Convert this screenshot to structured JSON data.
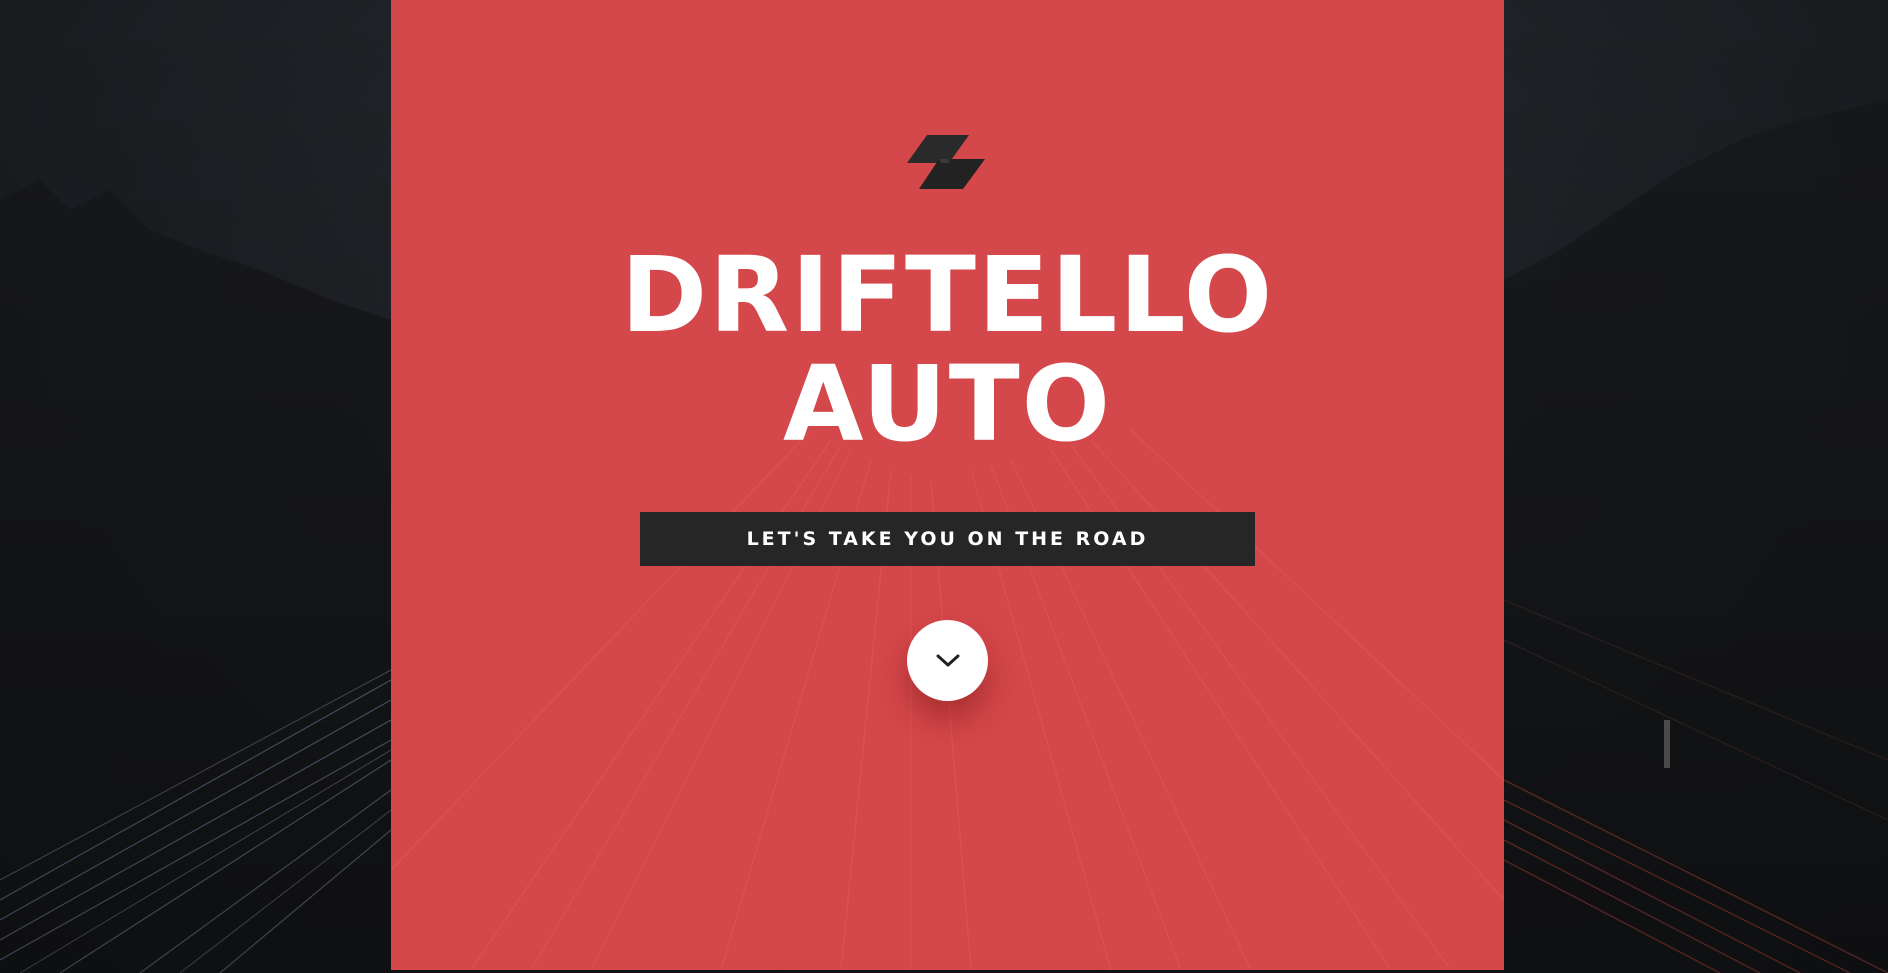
{
  "hero": {
    "brand_line_1": "DRIFTELLO",
    "brand_line_2": "AUTO",
    "cta_label": "LET'S TAKE YOU ON THE ROAD",
    "logo_icon": "stacked-parallelogram-logo-icon",
    "scroll_icon": "chevron-down-icon"
  },
  "colors": {
    "panel": "#d4474a",
    "background": "#1c1f22",
    "cta_background": "#262626",
    "text": "#ffffff"
  }
}
